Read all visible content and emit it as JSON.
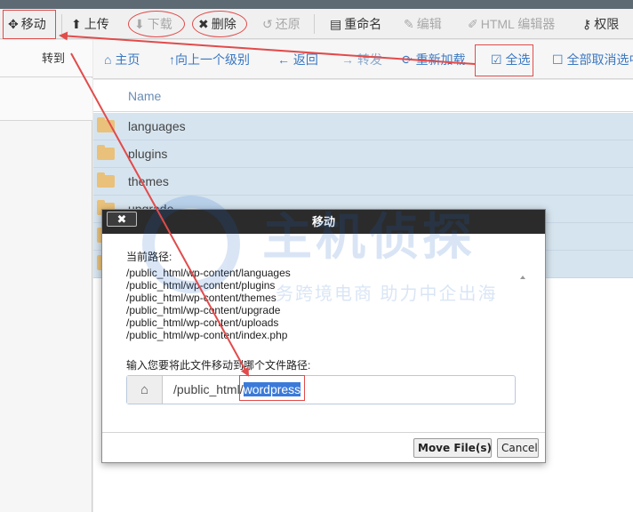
{
  "toolbar": {
    "move": "移动",
    "upload": "上传",
    "download": "下载",
    "delete": "删除",
    "restore": "还原",
    "rename": "重命名",
    "edit": "编辑",
    "html_editor": "HTML 编辑器",
    "permissions": "权限"
  },
  "left_panel": {
    "goto": "转到"
  },
  "nav": {
    "home": "主页",
    "up_level": "向上一个级别",
    "back": "返回",
    "forward": "转发",
    "reload": "重新加载",
    "select_all": "全选",
    "deselect_all": "全部取消选中"
  },
  "table": {
    "header_name": "Name",
    "rows": [
      {
        "name": "languages"
      },
      {
        "name": "plugins"
      },
      {
        "name": "themes"
      },
      {
        "name": "upgrade"
      }
    ]
  },
  "watermark": {
    "title": "主机侦探",
    "slogan": "务跨境电商 助力中企出海"
  },
  "modal": {
    "title": "移动",
    "close": "✖",
    "current_path_label": "当前路径:",
    "paths": [
      "/public_html/wp-content/languages",
      "/public_html/wp-content/plugins",
      "/public_html/wp-content/themes",
      "/public_html/wp-content/upgrade",
      "/public_html/wp-content/uploads",
      "/public_html/wp-content/index.php"
    ],
    "prompt_label": "输入您要将此文件移动到哪个文件路径:",
    "input_prefix": "/public_html/",
    "input_selected": "wordpress",
    "move_button": "Move File(s)",
    "cancel_button": "Cancel"
  },
  "colors": {
    "accent": "#3a78c2",
    "annotation": "#e24b4b",
    "selected_row": "#d6e4ef",
    "modal_header": "#2b2b2b"
  }
}
